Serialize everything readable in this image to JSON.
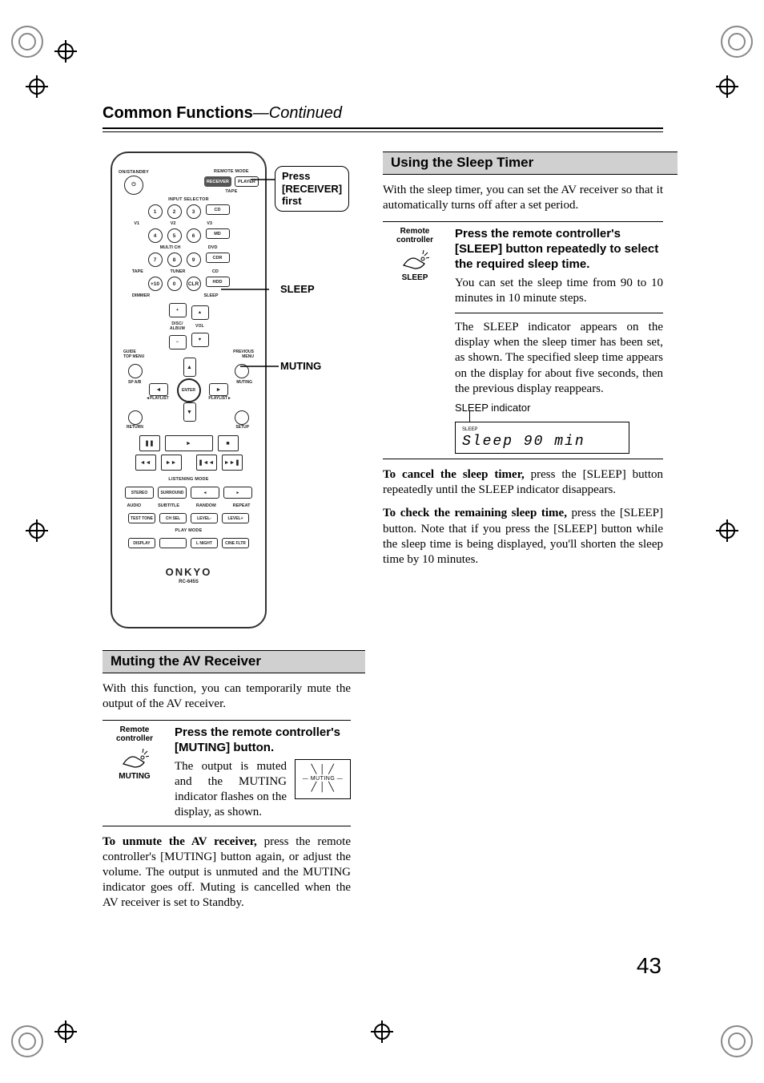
{
  "page_number": "43",
  "header": {
    "title_bold": "Common Functions",
    "title_italic": "—Continued"
  },
  "remote_callouts": {
    "receiver": "Press\n[RECEIVER]\nfirst",
    "sleep": "SLEEP",
    "muting": "MUTING"
  },
  "remote": {
    "on_standby": "ON/STANDBY",
    "remote_mode": "REMOTE MODE",
    "mode_btn_receiver": "RECEIVER",
    "mode_btn_player": "PLAYER",
    "tape_label": "TAPE",
    "input_selector": "INPUT SELECTOR",
    "row1": [
      "1",
      "2",
      "3"
    ],
    "row1_sub": [
      "V1",
      "V2",
      "V3"
    ],
    "row1_pill": "CD",
    "row2": [
      "4",
      "5",
      "6"
    ],
    "row2_sub": [
      "",
      "MULTI CH",
      "DVD"
    ],
    "row2_pill": "MD",
    "row3": [
      "7",
      "8",
      "9"
    ],
    "row3_sub": [
      "TAPE",
      "TUNER",
      "CD"
    ],
    "row3_pill": "CDR",
    "row4_left": "+10",
    "row4_mid": "0",
    "row4_clr": "CLR",
    "row4_disc": "HDD",
    "row4_sub": [
      "DIMMER",
      "",
      "SLEEP",
      ""
    ],
    "vol_disc_album": "DISC/\nALBUM",
    "vol_label": "VOL",
    "guide": "GUIDE\nTOP MENU",
    "prev_menu": "PREVIOUS\nMENU",
    "sp_ab": "SP A/B",
    "muting": "MUTING",
    "enter": "ENTER",
    "playlist_l": "◄PLAYLIST",
    "playlist_r": "PLAYLIST►",
    "return": "RETURN",
    "setup": "SETUP",
    "transport": {
      "pause": "❚❚",
      "play": "►",
      "stop": "■",
      "rew": "◄◄",
      "ff": "►►",
      "prev": "❚◄◄",
      "next": "►►❚"
    },
    "listening_mode": "LISTENING MODE",
    "lm": [
      "STEREO",
      "SURROUND",
      "◄",
      "►"
    ],
    "row_labels": [
      "AUDIO",
      "SUBTITLE",
      "RANDOM",
      "REPEAT"
    ],
    "row_btns2": [
      "TEST TONE",
      "CH SEL",
      "LEVEL-",
      "LEVEL+"
    ],
    "play_mode": "PLAY MODE",
    "row_btns3": [
      "DISPLAY",
      "",
      "L NIGHT",
      "CINE FLTR"
    ],
    "brand": "ONKYO",
    "model": "RC-645S"
  },
  "muting_section": {
    "title": "Muting the AV Receiver",
    "intro": "With this function, you can temporarily mute the output of the AV receiver.",
    "remote_label": "Remote\ncontroller",
    "button_label": "MUTING",
    "step_head": "Press the remote controller's [MUTING] button.",
    "step_body": "The output is muted and the MUTING indicator flashes on the display, as shown.",
    "indicator_label": "MUTING",
    "unmute": "To unmute the AV receiver, press the remote controller's [MUTING] button again, or adjust the volume. The output is unmuted and the MUTING indicator goes off. Muting is cancelled when the AV receiver is set to Standby.",
    "unmute_bold": "To unmute the AV receiver,"
  },
  "sleep_section": {
    "title": "Using the Sleep Timer",
    "intro": "With the sleep timer, you can set the AV receiver so that it automatically turns off after a set period.",
    "remote_label": "Remote\ncontroller",
    "button_label": "SLEEP",
    "step_head": "Press the remote controller's [SLEEP] button repeatedly to select the required sleep time.",
    "step_body1": "You can set the sleep time from 90 to 10 minutes in 10 minute steps.",
    "step_body2": "The SLEEP indicator appears on the display when the sleep timer has been set, as shown. The specified sleep time appears on the display for about five seconds, then the previous display reappears.",
    "indicator_caption": "SLEEP indicator",
    "display_tiny": "SLEEP",
    "display_seg": "Sleep 90 min",
    "cancel_bold": "To cancel the sleep timer,",
    "cancel_text": "To cancel the sleep timer, press the [SLEEP] button repeatedly until the SLEEP indicator disappears.",
    "check_bold": "To check the remaining sleep time,",
    "check_text": "To check the remaining sleep time, press the [SLEEP] button. Note that if you press the [SLEEP] button while the sleep time is being displayed, you'll shorten the sleep time by 10 minutes."
  }
}
